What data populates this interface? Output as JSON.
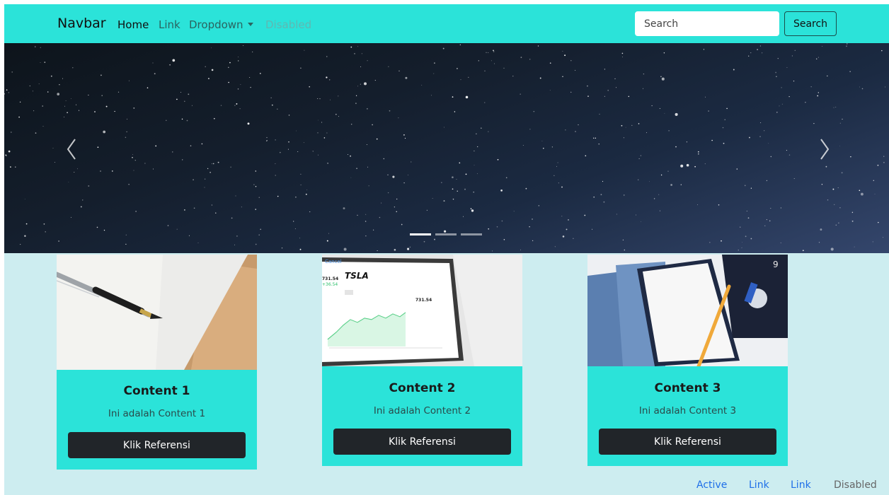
{
  "navbar": {
    "brand": "Navbar",
    "links": [
      {
        "label": "Home",
        "state": "active"
      },
      {
        "label": "Link",
        "state": "normal"
      },
      {
        "label": "Dropdown",
        "state": "normal"
      },
      {
        "label": "Disabled",
        "state": "disabled"
      }
    ],
    "search_placeholder": "Search",
    "search_button": "Search",
    "color": "#2be3d9"
  },
  "carousel": {
    "slide_count": 3,
    "active_index": 0,
    "prev_icon": "chevron-left-icon",
    "next_icon": "chevron-right-icon"
  },
  "cards": [
    {
      "title": "Content 1",
      "text": "Ini adalah Content 1",
      "button": "Klik Referensi",
      "image": "pen-notebook-photo"
    },
    {
      "title": "Content 2",
      "text": "Ini adalah Content 2",
      "button": "Klik Referensi",
      "image": "tablet-stock-chart-photo",
      "image_text": {
        "ticker": "TSLA",
        "price": "731.54",
        "price_small": "731.54",
        "change": "+36.54",
        "cancel": "Cancel"
      }
    },
    {
      "title": "Content 3",
      "text": "Ini adalah Content 3",
      "button": "Klik Referensi",
      "image": "notebook-pencil-photo",
      "image_text": {
        "card_number": "9"
      }
    }
  ],
  "bottom_nav": [
    {
      "label": "Active",
      "state": "active"
    },
    {
      "label": "Link",
      "state": "normal"
    },
    {
      "label": "Link",
      "state": "normal"
    },
    {
      "label": "Disabled",
      "state": "disabled"
    }
  ],
  "colors": {
    "background": "#cdedf0",
    "accent": "#2be3d9",
    "button_dark": "#212529",
    "link_blue": "#1f6fe8"
  }
}
